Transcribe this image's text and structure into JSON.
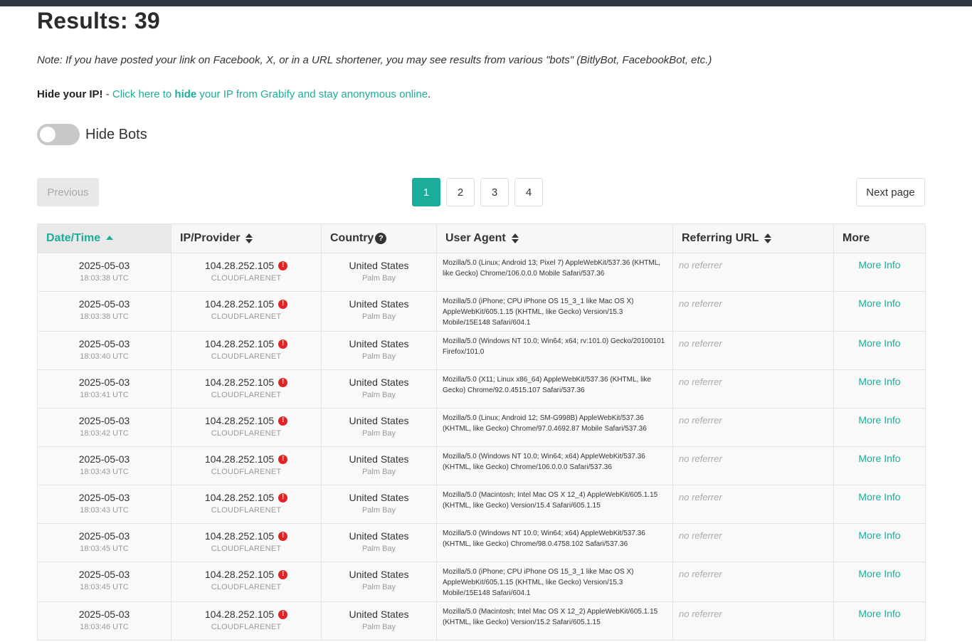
{
  "header": {
    "title": "Results: 39",
    "note": "Note: If you have posted your link on Facebook, X, or in a URL shortener, you may see results from various \"bots\" (BitlyBot, FacebookBot, etc.)",
    "hide_ip_label": "Hide your IP!",
    "hide_ip_sep": " - ",
    "hide_ip_link_pre": "Click here to ",
    "hide_ip_link_bold": "hide",
    "hide_ip_link_post": " your IP from Grabify and stay anonymous online",
    "hide_ip_end": "."
  },
  "toggle": {
    "label": "Hide Bots",
    "checked": false
  },
  "pagination": {
    "previous": "Previous",
    "next": "Next page",
    "pages": [
      "1",
      "2",
      "3",
      "4"
    ],
    "active": "1"
  },
  "table": {
    "columns": {
      "datetime": "Date/Time",
      "ip": "IP/Provider",
      "country": "Country",
      "ua": "User Agent",
      "ref": "Referring URL",
      "more": "More"
    },
    "more_label": "More Info",
    "warn_glyph": "!",
    "help_glyph": "?",
    "rows": [
      {
        "date": "2025-05-03",
        "time": "18:03:38 UTC",
        "ip": "104.28.252.105",
        "provider": "CLOUDFLARENET",
        "country": "United States",
        "city": "Palm Bay",
        "ua": "Mozilla/5.0 (Linux; Android 13; Pixel 7) AppleWebKit/537.36 (KHTML, like Gecko) Chrome/106.0.0.0 Mobile Safari/537.36",
        "ref": "no referrer"
      },
      {
        "date": "2025-05-03",
        "time": "18:03:38 UTC",
        "ip": "104.28.252.105",
        "provider": "CLOUDFLARENET",
        "country": "United States",
        "city": "Palm Bay",
        "ua": "Mozilla/5.0 (iPhone; CPU iPhone OS 15_3_1 like Mac OS X) AppleWebKit/605.1.15 (KHTML, like Gecko) Version/15.3 Mobile/15E148 Safari/604.1",
        "ref": "no referrer"
      },
      {
        "date": "2025-05-03",
        "time": "18:03:40 UTC",
        "ip": "104.28.252.105",
        "provider": "CLOUDFLARENET",
        "country": "United States",
        "city": "Palm Bay",
        "ua": "Mozilla/5.0 (Windows NT 10.0; Win64; x64; rv:101.0) Gecko/20100101 Firefox/101.0",
        "ref": "no referrer"
      },
      {
        "date": "2025-05-03",
        "time": "18:03:41 UTC",
        "ip": "104.28.252.105",
        "provider": "CLOUDFLARENET",
        "country": "United States",
        "city": "Palm Bay",
        "ua": "Mozilla/5.0 (X11; Linux x86_64) AppleWebKit/537.36 (KHTML, like Gecko) Chrome/92.0.4515.107 Safari/537.36",
        "ref": "no referrer"
      },
      {
        "date": "2025-05-03",
        "time": "18:03:42 UTC",
        "ip": "104.28.252.105",
        "provider": "CLOUDFLARENET",
        "country": "United States",
        "city": "Palm Bay",
        "ua": "Mozilla/5.0 (Linux; Android 12; SM-G998B) AppleWebKit/537.36 (KHTML, like Gecko) Chrome/97.0.4692.87 Mobile Safari/537.36",
        "ref": "no referrer"
      },
      {
        "date": "2025-05-03",
        "time": "18:03:43 UTC",
        "ip": "104.28.252.105",
        "provider": "CLOUDFLARENET",
        "country": "United States",
        "city": "Palm Bay",
        "ua": "Mozilla/5.0 (Windows NT 10.0; Win64; x64) AppleWebKit/537.36 (KHTML, like Gecko) Chrome/106.0.0.0 Safari/537.36",
        "ref": "no referrer"
      },
      {
        "date": "2025-05-03",
        "time": "18:03:43 UTC",
        "ip": "104.28.252.105",
        "provider": "CLOUDFLARENET",
        "country": "United States",
        "city": "Palm Bay",
        "ua": "Mozilla/5.0 (Macintosh; Intel Mac OS X 12_4) AppleWebKit/605.1.15 (KHTML, like Gecko) Version/15.4 Safari/605.1.15",
        "ref": "no referrer"
      },
      {
        "date": "2025-05-03",
        "time": "18:03:45 UTC",
        "ip": "104.28.252.105",
        "provider": "CLOUDFLARENET",
        "country": "United States",
        "city": "Palm Bay",
        "ua": "Mozilla/5.0 (Windows NT 10.0; Win64; x64) AppleWebKit/537.36 (KHTML, like Gecko) Chrome/98.0.4758.102 Safari/537.36",
        "ref": "no referrer"
      },
      {
        "date": "2025-05-03",
        "time": "18:03:45 UTC",
        "ip": "104.28.252.105",
        "provider": "CLOUDFLARENET",
        "country": "United States",
        "city": "Palm Bay",
        "ua": "Mozilla/5.0 (iPhone; CPU iPhone OS 15_3_1 like Mac OS X) AppleWebKit/605.1.15 (KHTML, like Gecko) Version/15.3 Mobile/15E148 Safari/604.1",
        "ref": "no referrer"
      },
      {
        "date": "2025-05-03",
        "time": "18:03:46 UTC",
        "ip": "104.28.252.105",
        "provider": "CLOUDFLARENET",
        "country": "United States",
        "city": "Palm Bay",
        "ua": "Mozilla/5.0 (Macintosh; Intel Mac OS X 12_2) AppleWebKit/605.1.15 (KHTML, like Gecko) Version/15.2 Safari/605.1.15",
        "ref": "no referrer"
      }
    ]
  },
  "colors": {
    "accent": "#1aae9a",
    "warn": "#e02424",
    "topbar": "#2f3640"
  }
}
